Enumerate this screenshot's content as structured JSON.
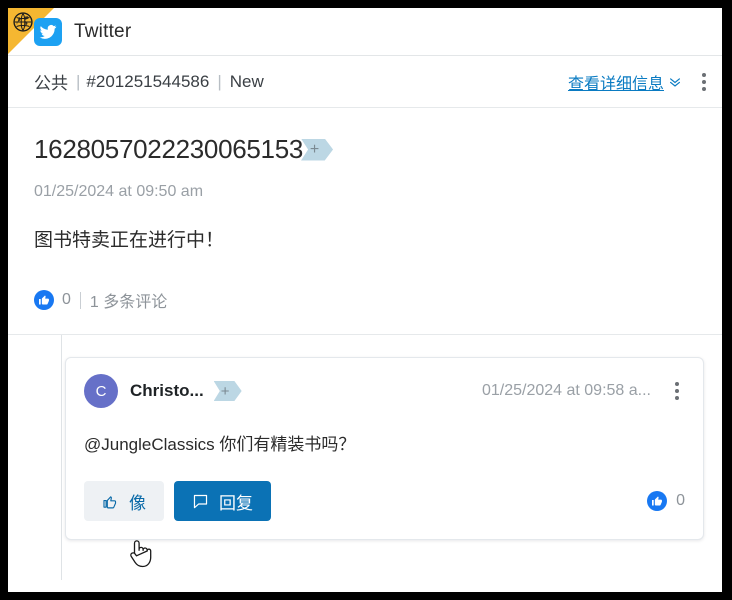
{
  "window": {
    "app_title": "Twitter",
    "corner_icon": "globe-icon",
    "brand_icon": "twitter-bird-icon"
  },
  "meta_bar": {
    "visibility": "公共",
    "separator": "|",
    "case_id": "#201251544586",
    "separator2": "|",
    "status": "New",
    "details_link": "查看详细信息",
    "details_chevron": "chevron-double-down-icon",
    "overflow_icon": "kebab-menu-icon"
  },
  "post": {
    "title": "1628057022230065153",
    "tag_badge": "+",
    "timestamp": "01/25/2024 at 09:50 am",
    "body": "图书特卖正在进行中！",
    "like_icon": "thumbs-up-filled-icon",
    "like_count": "0",
    "divider": "|",
    "comments_label": "1 多条评论"
  },
  "comment": {
    "avatar_initial": "C",
    "author": "Christo...",
    "tag_badge": "+",
    "timestamp": "01/25/2024 at 09:58 a...",
    "overflow_icon": "kebab-menu-icon",
    "body": "@JungleClassics 你们有精装书吗？",
    "like_button_label": "像",
    "like_button_icon": "thumbs-up-outline-icon",
    "reply_button_label": "回复",
    "reply_button_icon": "comment-bubble-icon",
    "like_icon": "thumbs-up-filled-icon",
    "like_count": "0"
  },
  "colors": {
    "brand_blue": "#1da1f2",
    "link_blue": "#0a7bc2",
    "reply_blue": "#0b72b5",
    "like_blue": "#1878f2",
    "tag_blue": "#bcd7e4",
    "avatar_purple": "#6670c8",
    "corner_yellow": "#f5b731",
    "muted_text": "#9aa0a6"
  }
}
